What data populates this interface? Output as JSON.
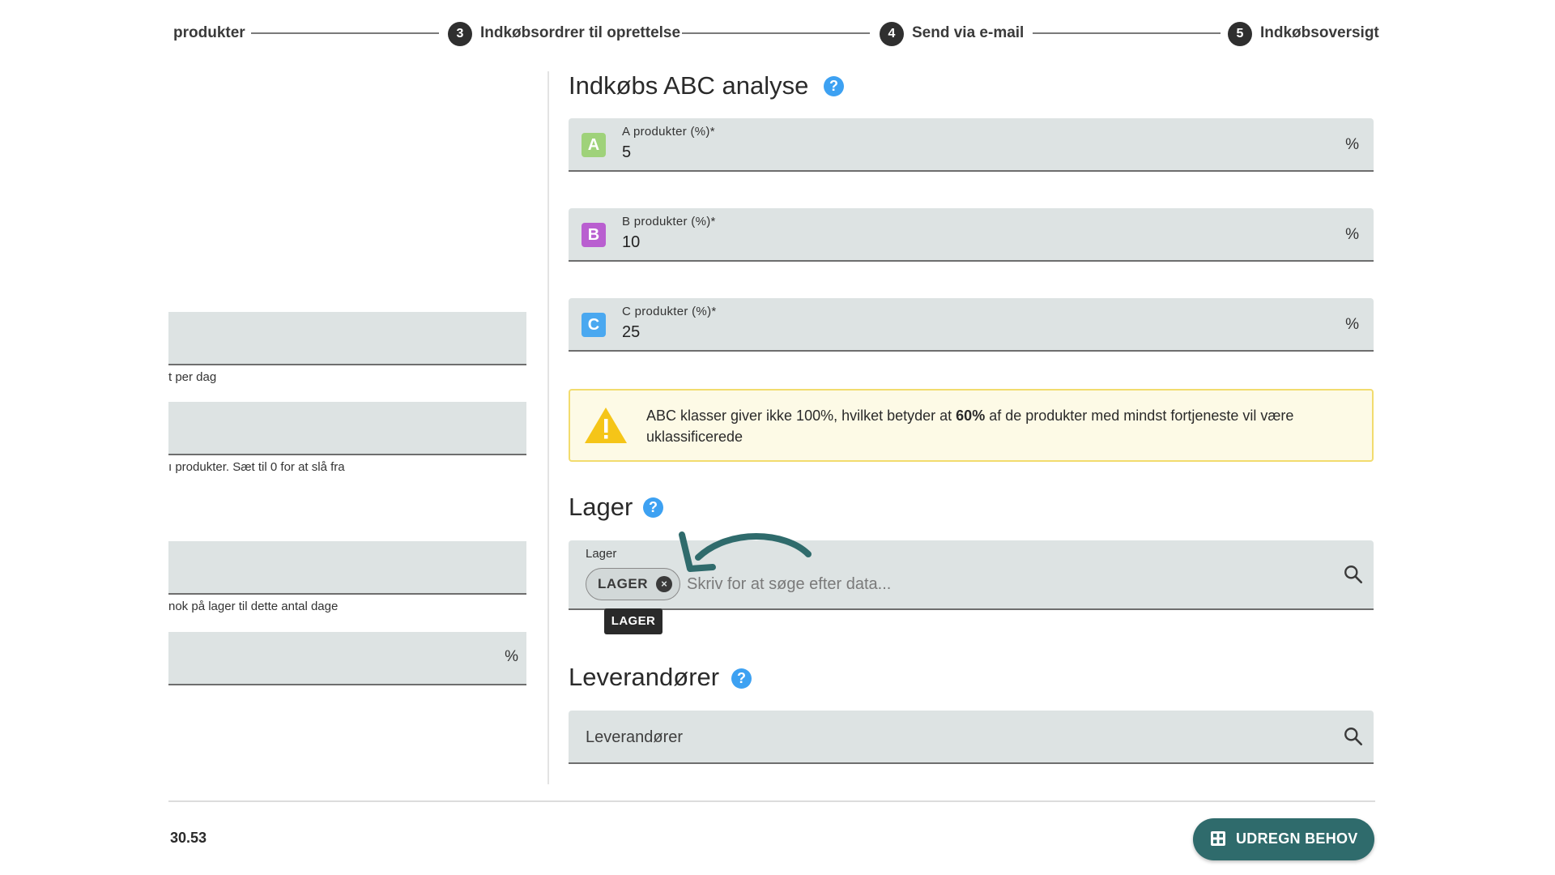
{
  "stepper": {
    "steps": [
      {
        "label": "produkter"
      },
      {
        "number": "3",
        "label": "Indkøbsordrer til oprettelse"
      },
      {
        "number": "4",
        "label": "Send via e-mail"
      },
      {
        "number": "5",
        "label": "Indkøbsoversigt"
      }
    ]
  },
  "left_panel": {
    "helper_1": "t per dag",
    "helper_2": "ı produkter. Sæt til 0 for at slå fra",
    "helper_3": "nok på lager til dette antal dage",
    "unit_4": "%"
  },
  "abc": {
    "title": "Indkøbs ABC analyse",
    "help": "?",
    "fields": [
      {
        "badge": "A",
        "label": "A produkter (%)*",
        "value": "5",
        "unit": "%",
        "badge_color": "#9fd27a"
      },
      {
        "badge": "B",
        "label": "B produkter (%)*",
        "value": "10",
        "unit": "%",
        "badge_color": "#b95fd0"
      },
      {
        "badge": "C",
        "label": "C produkter (%)*",
        "value": "25",
        "unit": "%",
        "badge_color": "#4aa8f0"
      }
    ],
    "warning": {
      "text_before": "ABC klasser giver ikke 100%, hvilket betyder at ",
      "bold": "60%",
      "text_after": " af de produkter med mindst fortjeneste vil være uklassificerede"
    }
  },
  "lager": {
    "title": "Lager",
    "help": "?",
    "field_label": "Lager",
    "chip": "LAGER",
    "chip_remove": "×",
    "placeholder": "Skriv for at søge efter data...",
    "tooltip": "LAGER"
  },
  "leverandorer": {
    "title": "Leverandører",
    "help": "?",
    "placeholder": "Leverandører"
  },
  "footer": {
    "number": "30.53",
    "button_label": "UDREGN BEHOV"
  },
  "colors": {
    "accent_button": "#2f6b6c",
    "help_icon": "#3da1f2",
    "warning_border": "#f2dc6e",
    "warning_icon": "#f5c518"
  }
}
